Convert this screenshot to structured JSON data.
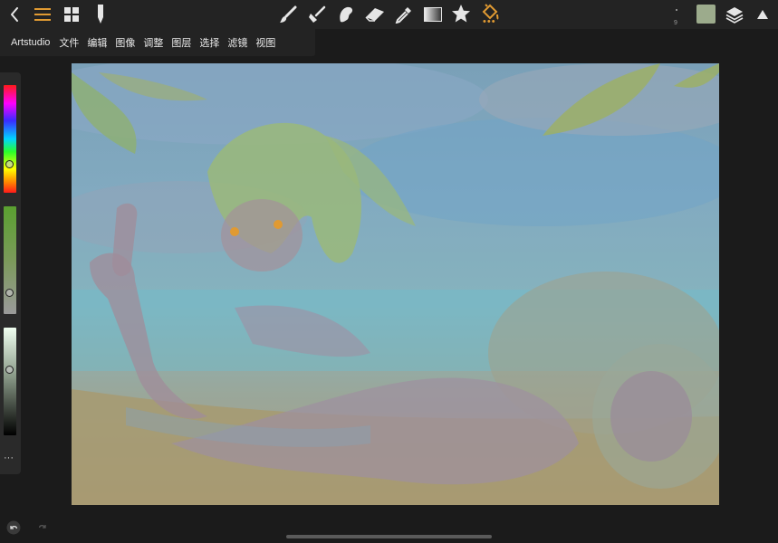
{
  "toolbar": {
    "tools": [
      "back-icon",
      "menu-icon",
      "gallery-grid-icon",
      "pencil-icon",
      "brush-icon",
      "smudge-icon",
      "blob-icon",
      "eraser-icon",
      "eyedropper-icon",
      "gradient-icon",
      "star-icon",
      "fill-bucket-icon"
    ],
    "brush_size": "9",
    "current_color": "#9cab8c",
    "accent_color": "#e09a32"
  },
  "menu": {
    "app_name": "Artstudio",
    "items": [
      "文件",
      "编辑",
      "图像",
      "调整",
      "图层",
      "选择",
      "滤镜",
      "视图"
    ]
  },
  "side_panel": {
    "more_label": "···"
  },
  "canvas": {
    "description_color_sky": "#7aa0b8"
  }
}
